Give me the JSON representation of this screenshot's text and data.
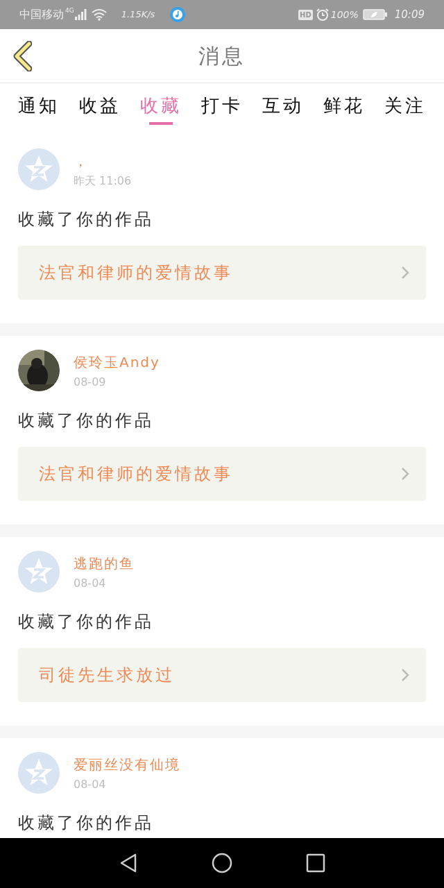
{
  "status_bar": {
    "carrier": "中国移动",
    "network": "4G",
    "speed": "1.15K/s",
    "hd": "HD",
    "battery": "100%",
    "time": "10:09"
  },
  "header": {
    "title": "消息"
  },
  "tabs": [
    {
      "label": "通知",
      "selected": false
    },
    {
      "label": "收益",
      "selected": false
    },
    {
      "label": "收藏",
      "selected": true
    },
    {
      "label": "打卡",
      "selected": false
    },
    {
      "label": "互动",
      "selected": false
    },
    {
      "label": "鲜花",
      "selected": false
    },
    {
      "label": "关注",
      "selected": false
    }
  ],
  "messages": [
    {
      "avatar": {
        "kind": "default"
      },
      "user": "，",
      "time": "昨天 11:06",
      "action": "收藏了你的作品",
      "work": "法官和律师的爱情故事"
    },
    {
      "user": "侯玲玉Andy",
      "time": "08-09",
      "action": "收藏了你的作品",
      "work": "法官和律师的爱情故事"
    },
    {
      "avatar": {
        "kind": "default"
      },
      "user": "逃跑的鱼",
      "time": "08-04",
      "action": "收藏了你的作品",
      "work": "司徒先生求放过"
    },
    {
      "avatar": {
        "kind": "default"
      },
      "user": "爱丽丝没有仙境",
      "time": "08-04",
      "action": "收藏了你的作品"
    }
  ]
}
